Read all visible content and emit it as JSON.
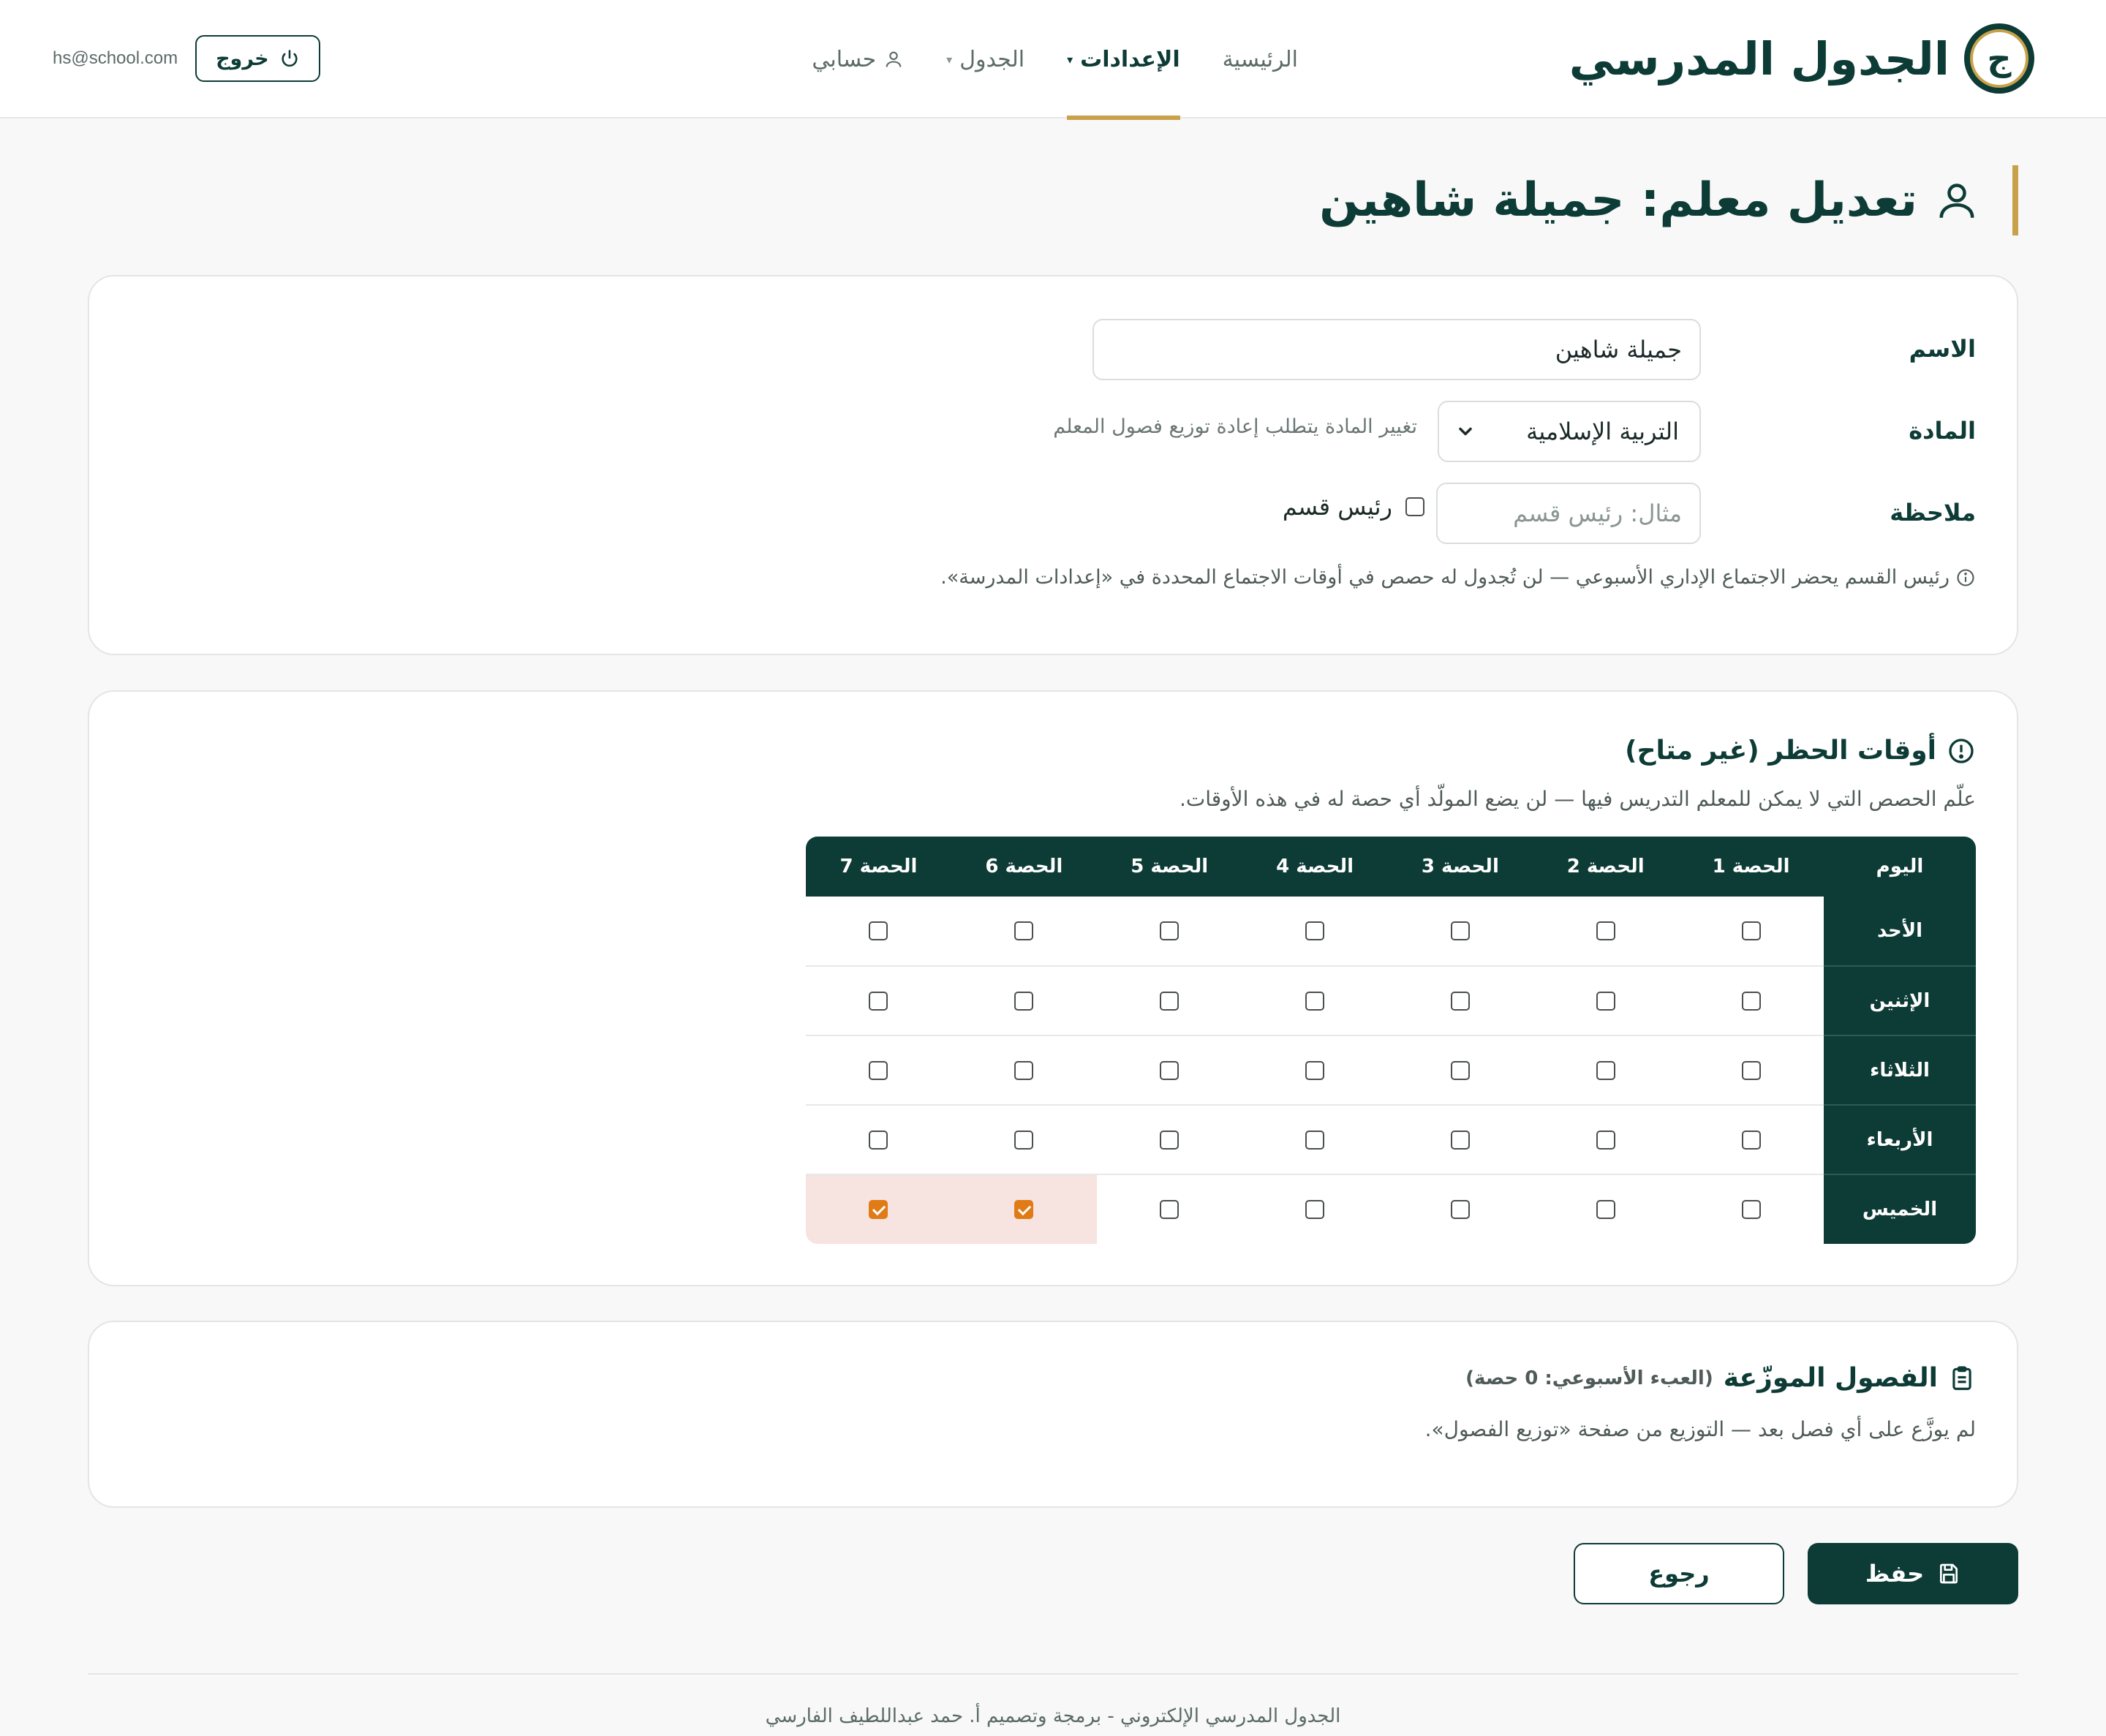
{
  "brand": {
    "logo_letter": "ج",
    "title": "الجدول المدرسي"
  },
  "nav": {
    "items": [
      {
        "label": "الرئيسية"
      },
      {
        "label": "الإعدادات"
      },
      {
        "label": "الجدول"
      },
      {
        "label": "حسابي"
      }
    ],
    "active": "الإعدادات",
    "user_email": "hs@school.com",
    "logout_label": "خروج"
  },
  "page": {
    "title": "تعديل معلم: جميلة شاهين"
  },
  "form": {
    "name_label": "الاسم",
    "name_value": "جميلة شاهين",
    "subject_label": "المادة",
    "subject_value": "التربية الإسلامية",
    "subject_hint": "تغيير المادة يتطلب إعادة توزيع فصول المعلم",
    "note_label": "ملاحظة",
    "note_placeholder": "مثال: رئيس قسم",
    "head_checkbox_label": "رئيس قسم",
    "info_text": "رئيس القسم يحضر الاجتماع الإداري الأسبوعي — لن تُجدول له حصص في أوقات الاجتماع المحددة في «إعدادات المدرسة»."
  },
  "blocked_times": {
    "title": "أوقات الحظر (غير متاح)",
    "description": "علّم الحصص التي لا يمكن للمعلم التدريس فيها — لن يضع المولّد أي حصة له في هذه الأوقات.",
    "day_header": "اليوم",
    "periods": [
      "الحصة 1",
      "الحصة 2",
      "الحصة 3",
      "الحصة 4",
      "الحصة 5",
      "الحصة 6",
      "الحصة 7"
    ],
    "days": [
      {
        "name": "الأحد",
        "blocked": [
          false,
          false,
          false,
          false,
          false,
          false,
          false
        ]
      },
      {
        "name": "الإثنين",
        "blocked": [
          false,
          false,
          false,
          false,
          false,
          false,
          false
        ]
      },
      {
        "name": "الثلاثاء",
        "blocked": [
          false,
          false,
          false,
          false,
          false,
          false,
          false
        ]
      },
      {
        "name": "الأربعاء",
        "blocked": [
          false,
          false,
          false,
          false,
          false,
          false,
          false
        ]
      },
      {
        "name": "الخميس",
        "blocked": [
          false,
          false,
          false,
          false,
          false,
          true,
          true
        ]
      }
    ]
  },
  "classes": {
    "title": "الفصول الموزّعة",
    "load_note": "(العبء الأسبوعي: 0 حصة)",
    "empty_message": "لم يوزَّع على أي فصل بعد — التوزيع من صفحة «توزيع الفصول»."
  },
  "actions": {
    "save_label": "حفظ",
    "back_label": "رجوع"
  },
  "footer": {
    "text": "الجدول المدرسي الإلكتروني - برمجة وتصميم أ. حمد عبداللطيف الفارسي"
  },
  "colors": {
    "primary": "#0d3b36",
    "accent": "#c9a14a",
    "checked": "#e07b16",
    "blocked_bg": "#f7e3df"
  },
  "icons": {
    "user": "user-icon",
    "power": "power-icon",
    "info": "info-icon",
    "alert": "alert-circle-icon",
    "clipboard": "clipboard-icon",
    "save": "save-icon",
    "chevron": "chevron-down-icon"
  }
}
